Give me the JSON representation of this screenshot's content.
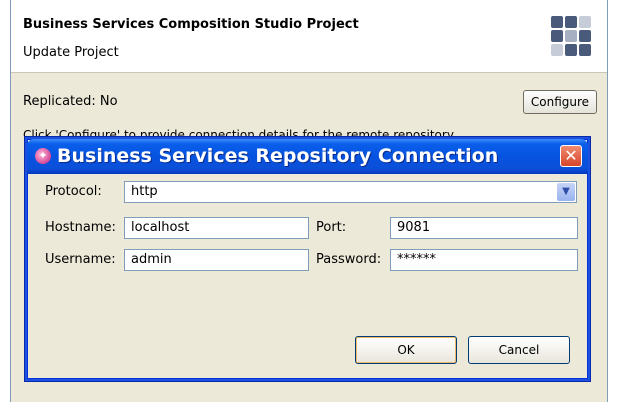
{
  "wizard": {
    "title": "Business Services Composition Studio Project",
    "subtitle": "Update Project",
    "replicated_text": "Replicated: No",
    "configure_label": "Configure",
    "instruction_text": "Click 'Configure' to provide connection details for the remote repository"
  },
  "dialog": {
    "title": "Business Services Repository Connection",
    "close_glyph": "✕",
    "protocol_label": "Protocol:",
    "protocol_value": "http",
    "hostname_label": "Hostname:",
    "hostname_value": "localhost",
    "port_label": "Port:",
    "port_value": "9081",
    "username_label": "Username:",
    "username_value": "admin",
    "password_label": "Password:",
    "password_value": "******",
    "ok_label": "OK",
    "cancel_label": "Cancel"
  },
  "icons": {
    "dialog_icon": "app-icon",
    "close": "close-icon",
    "dropdown": "chevron-down-icon",
    "wizard_logo": "grid-logo-icon"
  },
  "colors": {
    "titlebar": "#0653e0",
    "close_button": "#d8452a",
    "window_bg": "#ece9d8"
  }
}
